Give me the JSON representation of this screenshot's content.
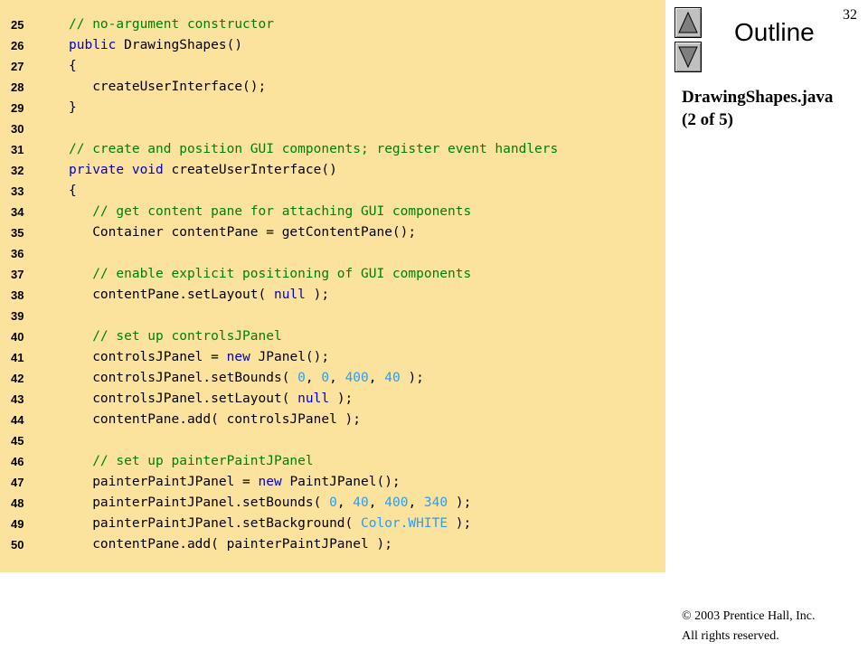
{
  "page_number": "32",
  "outline": {
    "title": "Outline",
    "file_name": "DrawingShapes.java",
    "part": "(2 of 5)"
  },
  "nav": {
    "up_icon": "triangle-up-icon",
    "down_icon": "triangle-down-icon"
  },
  "colors": {
    "panel": "#fbe29d",
    "comment": "#008000",
    "keyword": "#0000c8",
    "number": "#2a9df4"
  },
  "copyright": {
    "line1": "© 2003 Prentice Hall, Inc.",
    "line2": "All rights reserved."
  },
  "code_lines": [
    {
      "num": "25",
      "segments": [
        {
          "t": "// no-argument constructor",
          "k": "c"
        }
      ]
    },
    {
      "num": "26",
      "segments": [
        {
          "t": "public",
          "k": "k"
        },
        {
          "t": " DrawingShapes()",
          "k": "t"
        }
      ]
    },
    {
      "num": "27",
      "segments": [
        {
          "t": "{",
          "k": "t"
        }
      ]
    },
    {
      "num": "28",
      "segments": [
        {
          "t": "   createUserInterface();",
          "k": "t"
        }
      ]
    },
    {
      "num": "29",
      "segments": [
        {
          "t": "}",
          "k": "t"
        }
      ]
    },
    {
      "num": "30",
      "segments": []
    },
    {
      "num": "31",
      "segments": [
        {
          "t": "// create and position GUI components; register event handlers",
          "k": "c"
        }
      ]
    },
    {
      "num": "32",
      "segments": [
        {
          "t": "private",
          "k": "k"
        },
        {
          "t": " ",
          "k": "t"
        },
        {
          "t": "void",
          "k": "k"
        },
        {
          "t": " createUserInterface()",
          "k": "t"
        }
      ]
    },
    {
      "num": "33",
      "segments": [
        {
          "t": "{",
          "k": "t"
        }
      ]
    },
    {
      "num": "34",
      "segments": [
        {
          "t": "   // get content pane for attaching GUI components",
          "k": "c"
        }
      ]
    },
    {
      "num": "35",
      "segments": [
        {
          "t": "   Container contentPane = getContentPane();",
          "k": "t"
        }
      ]
    },
    {
      "num": "36",
      "segments": []
    },
    {
      "num": "37",
      "segments": [
        {
          "t": "   // enable explicit positioning of GUI components",
          "k": "c"
        }
      ]
    },
    {
      "num": "38",
      "segments": [
        {
          "t": "   contentPane.setLayout( ",
          "k": "t"
        },
        {
          "t": "null",
          "k": "k"
        },
        {
          "t": " );",
          "k": "t"
        }
      ]
    },
    {
      "num": "39",
      "segments": []
    },
    {
      "num": "40",
      "segments": [
        {
          "t": "   // set up controlsJPanel",
          "k": "c"
        }
      ]
    },
    {
      "num": "41",
      "segments": [
        {
          "t": "   controlsJPanel = ",
          "k": "t"
        },
        {
          "t": "new",
          "k": "k"
        },
        {
          "t": " JPanel();",
          "k": "t"
        }
      ]
    },
    {
      "num": "42",
      "segments": [
        {
          "t": "   controlsJPanel.setBounds( ",
          "k": "t"
        },
        {
          "t": "0",
          "k": "n"
        },
        {
          "t": ", ",
          "k": "t"
        },
        {
          "t": "0",
          "k": "n"
        },
        {
          "t": ", ",
          "k": "t"
        },
        {
          "t": "400",
          "k": "n"
        },
        {
          "t": ", ",
          "k": "t"
        },
        {
          "t": "40",
          "k": "n"
        },
        {
          "t": " );",
          "k": "t"
        }
      ]
    },
    {
      "num": "43",
      "segments": [
        {
          "t": "   controlsJPanel.setLayout( ",
          "k": "t"
        },
        {
          "t": "null",
          "k": "k"
        },
        {
          "t": " );",
          "k": "t"
        }
      ]
    },
    {
      "num": "44",
      "segments": [
        {
          "t": "   contentPane.add( controlsJPanel );",
          "k": "t"
        }
      ]
    },
    {
      "num": "45",
      "segments": []
    },
    {
      "num": "46",
      "segments": [
        {
          "t": "   // set up painterPaintJPanel",
          "k": "c"
        }
      ]
    },
    {
      "num": "47",
      "segments": [
        {
          "t": "   painterPaintJPanel = ",
          "k": "t"
        },
        {
          "t": "new",
          "k": "k"
        },
        {
          "t": " PaintJPanel();",
          "k": "t"
        }
      ]
    },
    {
      "num": "48",
      "segments": [
        {
          "t": "   painterPaintJPanel.setBounds( ",
          "k": "t"
        },
        {
          "t": "0",
          "k": "n"
        },
        {
          "t": ", ",
          "k": "t"
        },
        {
          "t": "40",
          "k": "n"
        },
        {
          "t": ", ",
          "k": "t"
        },
        {
          "t": "400",
          "k": "n"
        },
        {
          "t": ", ",
          "k": "t"
        },
        {
          "t": "340",
          "k": "n"
        },
        {
          "t": " );",
          "k": "t"
        }
      ]
    },
    {
      "num": "49",
      "segments": [
        {
          "t": "   painterPaintJPanel.setBackground( ",
          "k": "t"
        },
        {
          "t": "Color.WHITE",
          "k": "n"
        },
        {
          "t": " );",
          "k": "t"
        }
      ]
    },
    {
      "num": "50",
      "segments": [
        {
          "t": "   contentPane.add( painterPaintJPanel );",
          "k": "t"
        }
      ]
    }
  ]
}
